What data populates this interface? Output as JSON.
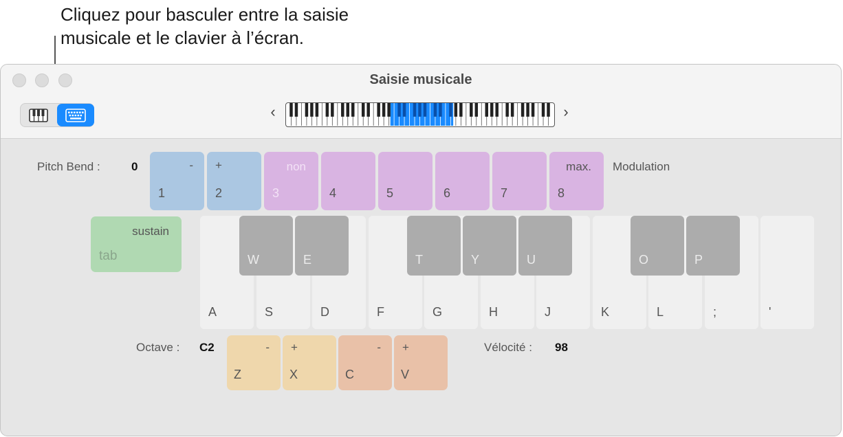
{
  "callout": {
    "line1": "Cliquez pour basculer entre la saisie",
    "line2": "musicale et le clavier à l’écran."
  },
  "window": {
    "title": "Saisie musicale",
    "view_toggle": {
      "options": [
        "piano-keyboard",
        "musical-typing"
      ],
      "selected": "musical-typing"
    },
    "range": {
      "prev_label": "‹",
      "next_label": "›",
      "highlight_fraction_start": 0.39,
      "highlight_fraction_end": 0.625
    }
  },
  "pitch_bend": {
    "label": "Pitch Bend :",
    "value": "0"
  },
  "modulation": {
    "label": "Modulation"
  },
  "number_pads": [
    {
      "num": "1",
      "top": "-",
      "group": "pitch"
    },
    {
      "num": "2",
      "top": "+",
      "group": "pitch"
    },
    {
      "num": "3",
      "top": "non",
      "group": "mod",
      "dim": true
    },
    {
      "num": "4",
      "top": "",
      "group": "mod"
    },
    {
      "num": "5",
      "top": "",
      "group": "mod"
    },
    {
      "num": "6",
      "top": "",
      "group": "mod"
    },
    {
      "num": "7",
      "top": "",
      "group": "mod"
    },
    {
      "num": "8",
      "top": "max.",
      "group": "mod"
    }
  ],
  "sustain": {
    "label": "sustain",
    "key": "tab"
  },
  "white_keys": [
    "A",
    "S",
    "D",
    "F",
    "G",
    "H",
    "J",
    "K",
    "L",
    ";",
    "'"
  ],
  "black_keys": [
    "W",
    "E",
    "T",
    "Y",
    "U",
    "O",
    "P"
  ],
  "octave": {
    "label": "Octave :",
    "value": "C2"
  },
  "velocity": {
    "label": "Vélocité :",
    "value": "98"
  },
  "bottom_pads": [
    {
      "key": "Z",
      "top": "-",
      "group": "octave"
    },
    {
      "key": "X",
      "top": "+",
      "group": "octave"
    },
    {
      "key": "C",
      "top": "-",
      "group": "velocity"
    },
    {
      "key": "V",
      "top": "+",
      "group": "velocity"
    }
  ],
  "colors": {
    "pitch": "#abc7e2",
    "mod": "#d9b4e2",
    "sustain": "#b0d9b2",
    "octave": "#efd7ac",
    "velocity": "#e9c1a8",
    "accent": "#1a8bff"
  }
}
